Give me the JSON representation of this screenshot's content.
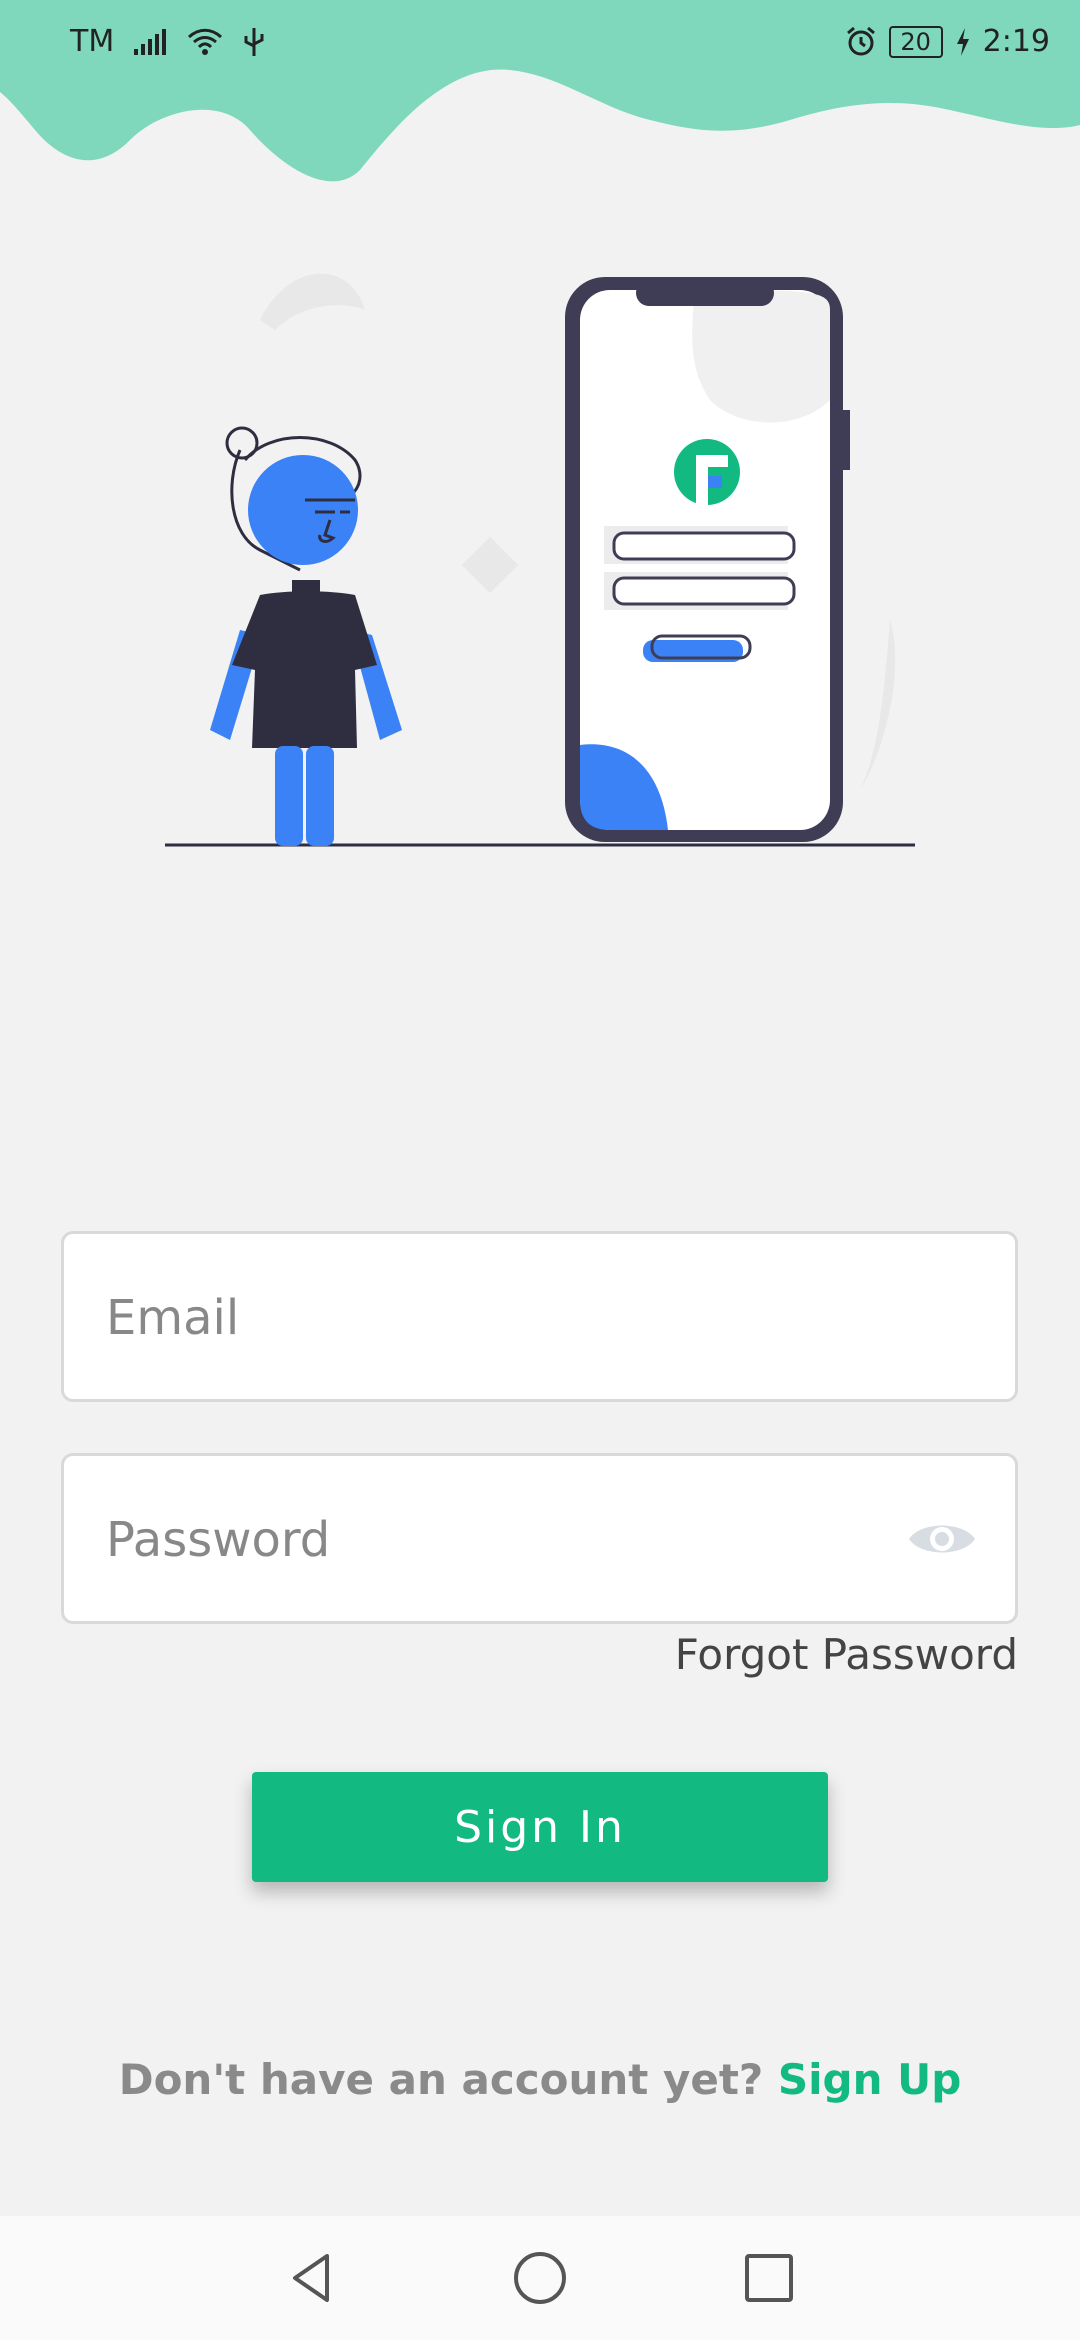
{
  "status_bar": {
    "carrier": "TM",
    "battery": "20",
    "time": "2:19"
  },
  "login": {
    "email_placeholder": "Email",
    "password_placeholder": "Password",
    "forgot_password": "Forgot Password",
    "sign_in": "Sign In",
    "signup_prompt": "Don't have an account yet? ",
    "signup_link": "Sign Up"
  },
  "colors": {
    "accent": "#12b981",
    "wave": "#7fd8bb",
    "illustration_blue": "#3b82f6",
    "illustration_dark": "#2f2e41"
  },
  "icons": {
    "status_left": [
      "signal-icon",
      "wifi-icon",
      "usb-icon"
    ],
    "status_right": [
      "alarm-icon",
      "battery-icon",
      "charging-icon"
    ],
    "nav": [
      "back-icon",
      "home-icon",
      "recents-icon"
    ],
    "password": "eye-icon"
  }
}
